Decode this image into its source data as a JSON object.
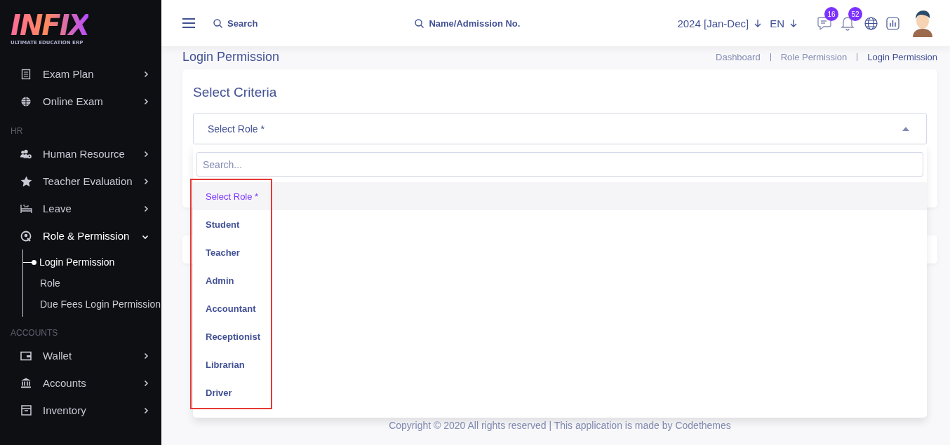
{
  "sidebar": {
    "logo_text": "INFIX",
    "logo_tagline": "ULTIMATE EDUCATION ERP",
    "groups": [
      {
        "items": [
          {
            "label": "Exam Plan",
            "expanded": false
          },
          {
            "label": "Online Exam",
            "expanded": false
          }
        ]
      },
      {
        "heading": "HR",
        "items": [
          {
            "label": "Human Resource",
            "expanded": false
          },
          {
            "label": "Teacher Evaluation",
            "expanded": false
          },
          {
            "label": "Leave",
            "expanded": false
          },
          {
            "label": "Role & Permission",
            "expanded": true,
            "children": [
              {
                "label": "Login Permission",
                "selected": true
              },
              {
                "label": "Role",
                "selected": false
              },
              {
                "label": "Due Fees Login Permission",
                "selected": false
              }
            ]
          }
        ]
      },
      {
        "heading": "ACCOUNTS",
        "items": [
          {
            "label": "Wallet",
            "expanded": false
          },
          {
            "label": "Accounts",
            "expanded": false
          },
          {
            "label": "Inventory",
            "expanded": false
          }
        ]
      }
    ]
  },
  "topbar": {
    "search_placeholder": "Search",
    "student_search_placeholder": "Name/Admission No.",
    "session": "2024 [Jan-Dec]",
    "language": "EN",
    "message_count": "16",
    "notification_count": "52"
  },
  "page": {
    "title": "Login Permission",
    "breadcrumbs": [
      {
        "label": "Dashboard",
        "current": false
      },
      {
        "label": "Role Permission",
        "current": false
      },
      {
        "label": "Login Permission",
        "current": true
      }
    ]
  },
  "criteria": {
    "title": "Select Criteria",
    "select": {
      "value": "Select Role *",
      "open": true
    },
    "dropdown": {
      "search_placeholder": "Search...",
      "highlighted": true,
      "options": [
        {
          "label": "Select Role *",
          "selected": true
        },
        {
          "label": "Student",
          "selected": false
        },
        {
          "label": "Teacher",
          "selected": false
        },
        {
          "label": "Admin",
          "selected": false
        },
        {
          "label": "Accountant",
          "selected": false
        },
        {
          "label": "Receptionist",
          "selected": false
        },
        {
          "label": "Librarian",
          "selected": false
        },
        {
          "label": "Driver",
          "selected": false
        }
      ]
    }
  },
  "footer": "Copyright © 2020 All rights reserved | This application is made by Codethemes"
}
